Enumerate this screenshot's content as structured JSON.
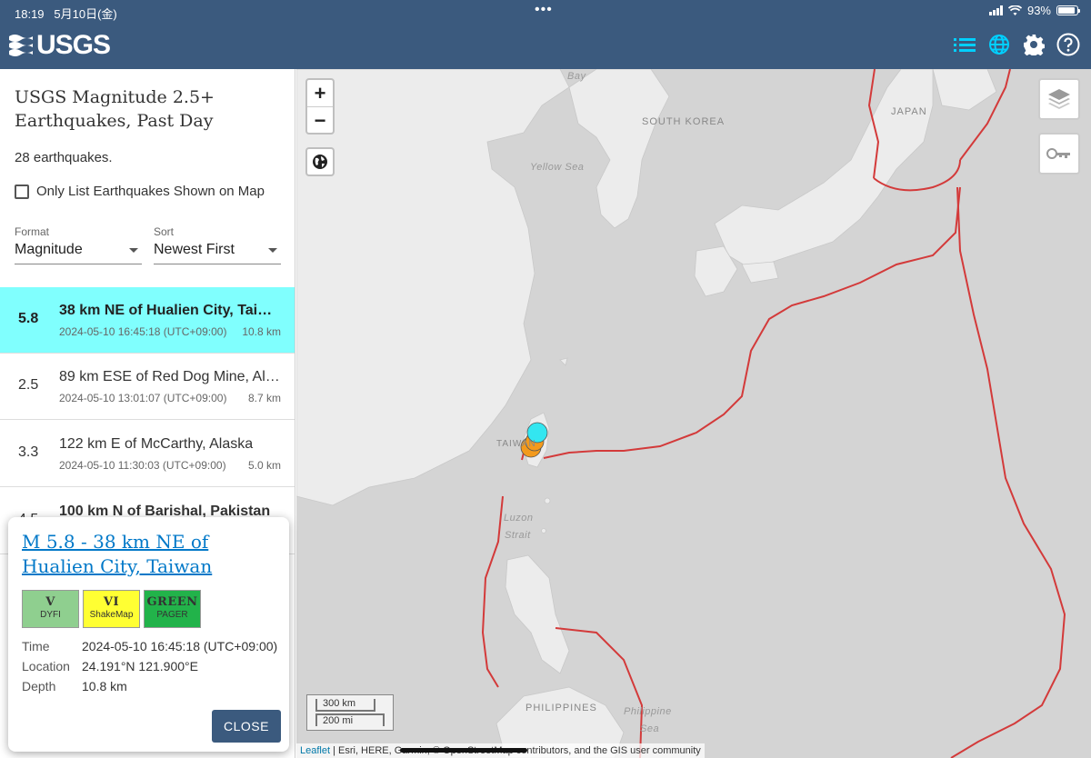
{
  "status": {
    "time": "18:19",
    "date": "5月10日(金)",
    "battery": "93%"
  },
  "header": {
    "logo": "USGS",
    "icons": [
      "list-icon",
      "globe-icon",
      "gear-icon",
      "help-icon"
    ],
    "active_color": "#00d0ff",
    "bar_color": "#3b5a7e"
  },
  "panel": {
    "title": "USGS Magnitude 2.5+ Earthquakes, Past Day",
    "count": "28 earthquakes.",
    "only_list_label": "Only List Earthquakes Shown on Map",
    "format_label": "Format",
    "format_value": "Magnitude",
    "sort_label": "Sort",
    "sort_value": "Newest First",
    "quakes": [
      {
        "mag": "5.8",
        "place": "38 km NE of Hualien City, Taiwan",
        "time": "2024-05-10 16:45:18 (UTC+09:00)",
        "depth": "10.8 km"
      },
      {
        "mag": "2.5",
        "place": "89 km ESE of Red Dog Mine, Alaska",
        "time": "2024-05-10 13:01:07 (UTC+09:00)",
        "depth": "8.7 km"
      },
      {
        "mag": "3.3",
        "place": "122 km E of McCarthy, Alaska",
        "time": "2024-05-10 11:30:03 (UTC+09:00)",
        "depth": "5.0 km"
      },
      {
        "mag": "4.5",
        "place": "100 km N of Barishal, Pakistan",
        "time": "",
        "depth": ""
      }
    ],
    "highlight_color": "#80fffe"
  },
  "map": {
    "zoom_in": "+",
    "zoom_out": "−",
    "labels": {
      "south_korea": "SOUTH KOREA",
      "japan": "JAPAN",
      "taiwan": "TAIWAN",
      "philippines": "PHILIPPINES",
      "bay": "Bay",
      "yellow_sea": "Yellow Sea",
      "luzon_strait_1": "Luzon",
      "luzon_strait_2": "Strait",
      "philippine_sea_1": "Philippine",
      "philippine_sea_2": "Sea"
    },
    "scale_km": "300 km",
    "scale_mi": "200 mi",
    "attribution_link": "Leaflet",
    "attribution_text": " | Esri, HERE, Garmin, © OpenStreetMap contributors, and the GIS user community",
    "plate_color": "#d33a3a",
    "quake_colors": {
      "selected": "#33e6f0",
      "other": "#f39a1c"
    }
  },
  "popup": {
    "title": "M 5.8 - 38 km NE of Hualien City, Taiwan",
    "badges": [
      {
        "value": "V",
        "label": "DYFI",
        "color": "#8fcf8f"
      },
      {
        "value": "VI",
        "label": "ShakeMap",
        "color": "#ffff33"
      },
      {
        "value": "GREEN",
        "label": "PAGER",
        "color": "#22b34a"
      }
    ],
    "time_label": "Time",
    "time_value": "2024-05-10 16:45:18 (UTC+09:00)",
    "location_label": "Location",
    "location_value": "24.191°N 121.900°E",
    "depth_label": "Depth",
    "depth_value": "10.8 km",
    "close_label": "CLOSE"
  }
}
